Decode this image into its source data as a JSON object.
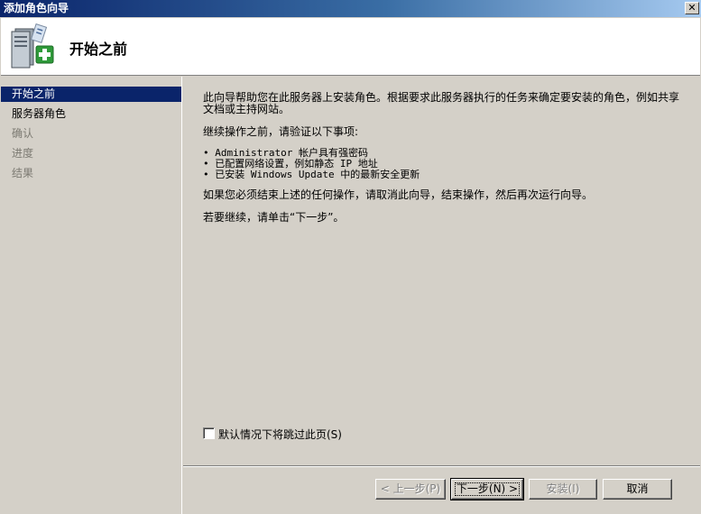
{
  "window": {
    "title": "添加角色向导",
    "close_glyph": "✕"
  },
  "header": {
    "title": "开始之前",
    "icon": "server-add-role-icon"
  },
  "sidebar": {
    "items": [
      {
        "label": "开始之前",
        "state": "active"
      },
      {
        "label": "服务器角色",
        "state": "enabled"
      },
      {
        "label": "确认",
        "state": "disabled"
      },
      {
        "label": "进度",
        "state": "disabled"
      },
      {
        "label": "结果",
        "state": "disabled"
      }
    ]
  },
  "content": {
    "intro": "此向导帮助您在此服务器上安装角色。根据要求此服务器执行的任务来确定要安装的角色，例如共享文档或主持网站。",
    "verify_heading": "继续操作之前，请验证以下事项:",
    "bullets": [
      "Administrator 帐户具有强密码",
      "已配置网络设置，例如静态 IP 地址",
      "已安装 Windows Update 中的最新安全更新"
    ],
    "warning": "如果您必须结束上述的任何操作，请取消此向导，结束操作，然后再次运行向导。",
    "continue_text": "若要继续，请单击“下一步”。",
    "skip_checkbox_label": "默认情况下将跳过此页(S)",
    "skip_checkbox_checked": false
  },
  "buttons": {
    "prev": "< 上一步(P)",
    "next": "下一步(N) >",
    "install": "安装(I)",
    "cancel": "取消"
  }
}
